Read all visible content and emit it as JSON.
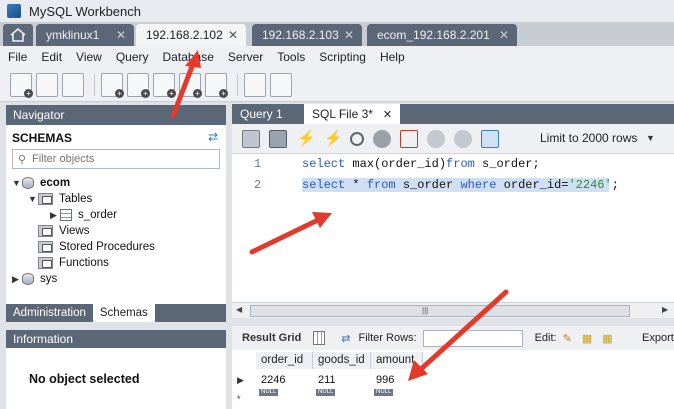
{
  "window": {
    "title": "MySQL Workbench"
  },
  "connection_tabs": [
    {
      "label": "ymklinux1",
      "active": false
    },
    {
      "label": "192.168.2.102",
      "active": true
    },
    {
      "label": "192.168.2.103",
      "active": false
    },
    {
      "label": "ecom_192.168.2.201",
      "active": false
    }
  ],
  "menu": [
    "File",
    "Edit",
    "View",
    "Query",
    "Database",
    "Server",
    "Tools",
    "Scripting",
    "Help"
  ],
  "navigator": {
    "header": "Navigator",
    "schemas_title": "SCHEMAS",
    "filter_placeholder": "Filter objects",
    "tree": {
      "ecom": "ecom",
      "tables": "Tables",
      "s_order": "s_order",
      "views": "Views",
      "stored_procedures": "Stored Procedures",
      "functions": "Functions",
      "sys": "sys"
    },
    "tabs": {
      "administration": "Administration",
      "schemas": "Schemas"
    }
  },
  "information": {
    "header": "Information",
    "message": "No object selected"
  },
  "query_tabs": [
    {
      "label": "Query 1"
    },
    {
      "label": "SQL File 3*"
    }
  ],
  "limit_select": "Limit to 2000 rows",
  "editor": {
    "lines": [
      {
        "num": "1",
        "a": "select",
        "b": " max(order_id)",
        "c": "from",
        "d": " s_order;"
      },
      {
        "num": "2",
        "a": "select",
        "b": " * ",
        "c": "from",
        "d": " s_order ",
        "e": "where",
        "f": " order_id=",
        "g": "'2246'",
        "h": ";"
      }
    ]
  },
  "result_toolbar": {
    "result_grid": "Result Grid",
    "filter_rows": "Filter Rows:",
    "edit": "Edit:",
    "export": "Export/"
  },
  "grid": {
    "columns": [
      "order_id",
      "goods_id",
      "amount"
    ],
    "rows": [
      [
        "2246",
        "211",
        "996"
      ]
    ],
    "null_label": "NULL",
    "new_row_marker": "*"
  }
}
